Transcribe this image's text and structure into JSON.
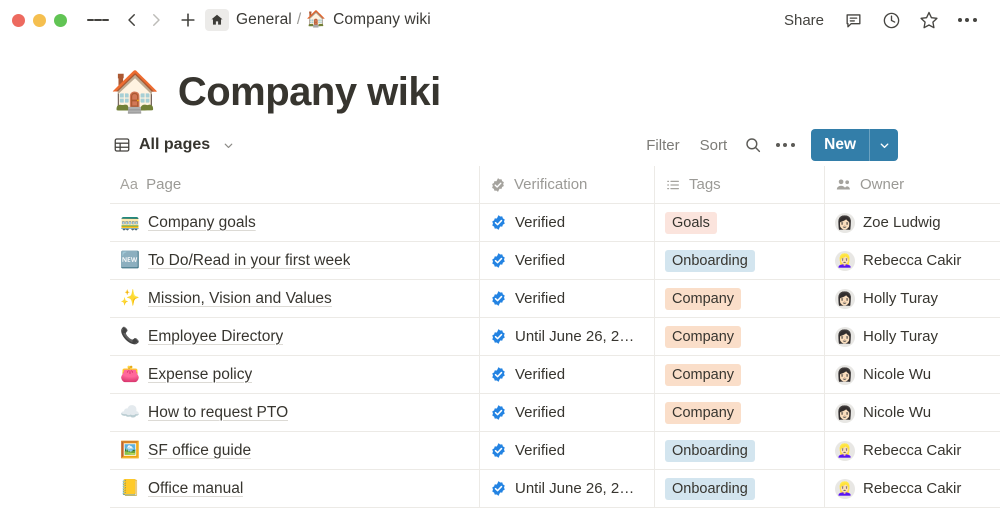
{
  "window": {
    "traffic_lights": [
      "close",
      "minimize",
      "zoom"
    ],
    "menu_icon": "hamburger-icon",
    "back_icon": "chevron-left-icon",
    "forward_icon": "chevron-right-icon",
    "new_tab_icon": "plus-icon",
    "colors": {
      "close": "#ed6a5f",
      "minimize": "#f5bf4f",
      "zoom": "#61c454",
      "accent_blue": "#337ea9"
    }
  },
  "breadcrumb": {
    "home_icon": "home-icon",
    "parent": "General",
    "separator": "/",
    "current_emoji": "🏠",
    "current": "Company wiki"
  },
  "topbar_actions": {
    "share_label": "Share",
    "comment_icon": "comment-icon",
    "history_icon": "clock-icon",
    "favorite_icon": "star-icon",
    "more_icon": "more-horizontal-icon"
  },
  "page": {
    "emoji": "🏠",
    "title": "Company wiki"
  },
  "view": {
    "icon": "table-grid-icon",
    "name": "All pages",
    "caret_icon": "chevron-down-icon",
    "filter_label": "Filter",
    "sort_label": "Sort",
    "search_icon": "search-icon",
    "more_icon": "more-horizontal-icon",
    "new_label": "New",
    "new_caret_icon": "chevron-down-icon"
  },
  "table": {
    "columns": [
      {
        "label": "Page",
        "icon": "text-type-icon"
      },
      {
        "label": "Verification",
        "icon": "verified-badge-icon"
      },
      {
        "label": "Tags",
        "icon": "multi-select-icon"
      },
      {
        "label": "Owner",
        "icon": "person-group-icon"
      }
    ],
    "rows": [
      {
        "emoji": "🚃",
        "page": "Company goals",
        "verification": "Verified",
        "tag": "Goals",
        "tag_style": "tag-goals",
        "owner": "Zoe Ludwig",
        "avatar": "👩🏻"
      },
      {
        "emoji": "🆕",
        "page": "To Do/Read in your first week",
        "verification": "Verified",
        "tag": "Onboarding",
        "tag_style": "tag-onboarding",
        "owner": "Rebecca Cakir",
        "avatar": "👱🏻‍♀️"
      },
      {
        "emoji": "✨",
        "page": "Mission, Vision and Values",
        "verification": "Verified",
        "tag": "Company",
        "tag_style": "tag-company",
        "owner": "Holly Turay",
        "avatar": "👩🏻"
      },
      {
        "emoji": "📞",
        "page": "Employee Directory",
        "verification": "Until June 26, 2…",
        "tag": "Company",
        "tag_style": "tag-company",
        "owner": "Holly Turay",
        "avatar": "👩🏻"
      },
      {
        "emoji": "👛",
        "page": "Expense policy",
        "verification": "Verified",
        "tag": "Company",
        "tag_style": "tag-company",
        "owner": "Nicole Wu",
        "avatar": "👩🏻"
      },
      {
        "emoji": "☁️",
        "page": "How to request PTO",
        "verification": "Verified",
        "tag": "Company",
        "tag_style": "tag-company",
        "owner": "Nicole Wu",
        "avatar": "👩🏻"
      },
      {
        "emoji": "🖼️",
        "page": "SF office guide",
        "verification": "Verified",
        "tag": "Onboarding",
        "tag_style": "tag-onboarding",
        "owner": "Rebecca Cakir",
        "avatar": "👱🏻‍♀️"
      },
      {
        "emoji": "📒",
        "page": "Office manual",
        "verification": "Until June 26, 2…",
        "tag": "Onboarding",
        "tag_style": "tag-onboarding",
        "owner": "Rebecca Cakir",
        "avatar": "👱🏻‍♀️"
      }
    ]
  }
}
